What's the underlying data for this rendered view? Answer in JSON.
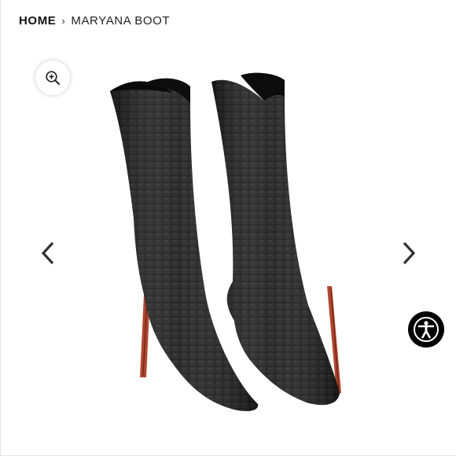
{
  "breadcrumb": {
    "home": "HOME",
    "separator": "›",
    "current": "MARYANA BOOT"
  },
  "gallery": {
    "zoom_icon": "zoom-in-icon",
    "prev_icon": "chevron-left-icon",
    "next_icon": "chevron-right-icon",
    "product": "black croc-embossed knee-high stiletto boots"
  },
  "accessibility": {
    "icon": "accessibility-person-icon"
  },
  "colors": {
    "background": "#ffffff",
    "boot": "#161616",
    "heel": "#b0462f",
    "accessibility_bg": "#000000"
  }
}
